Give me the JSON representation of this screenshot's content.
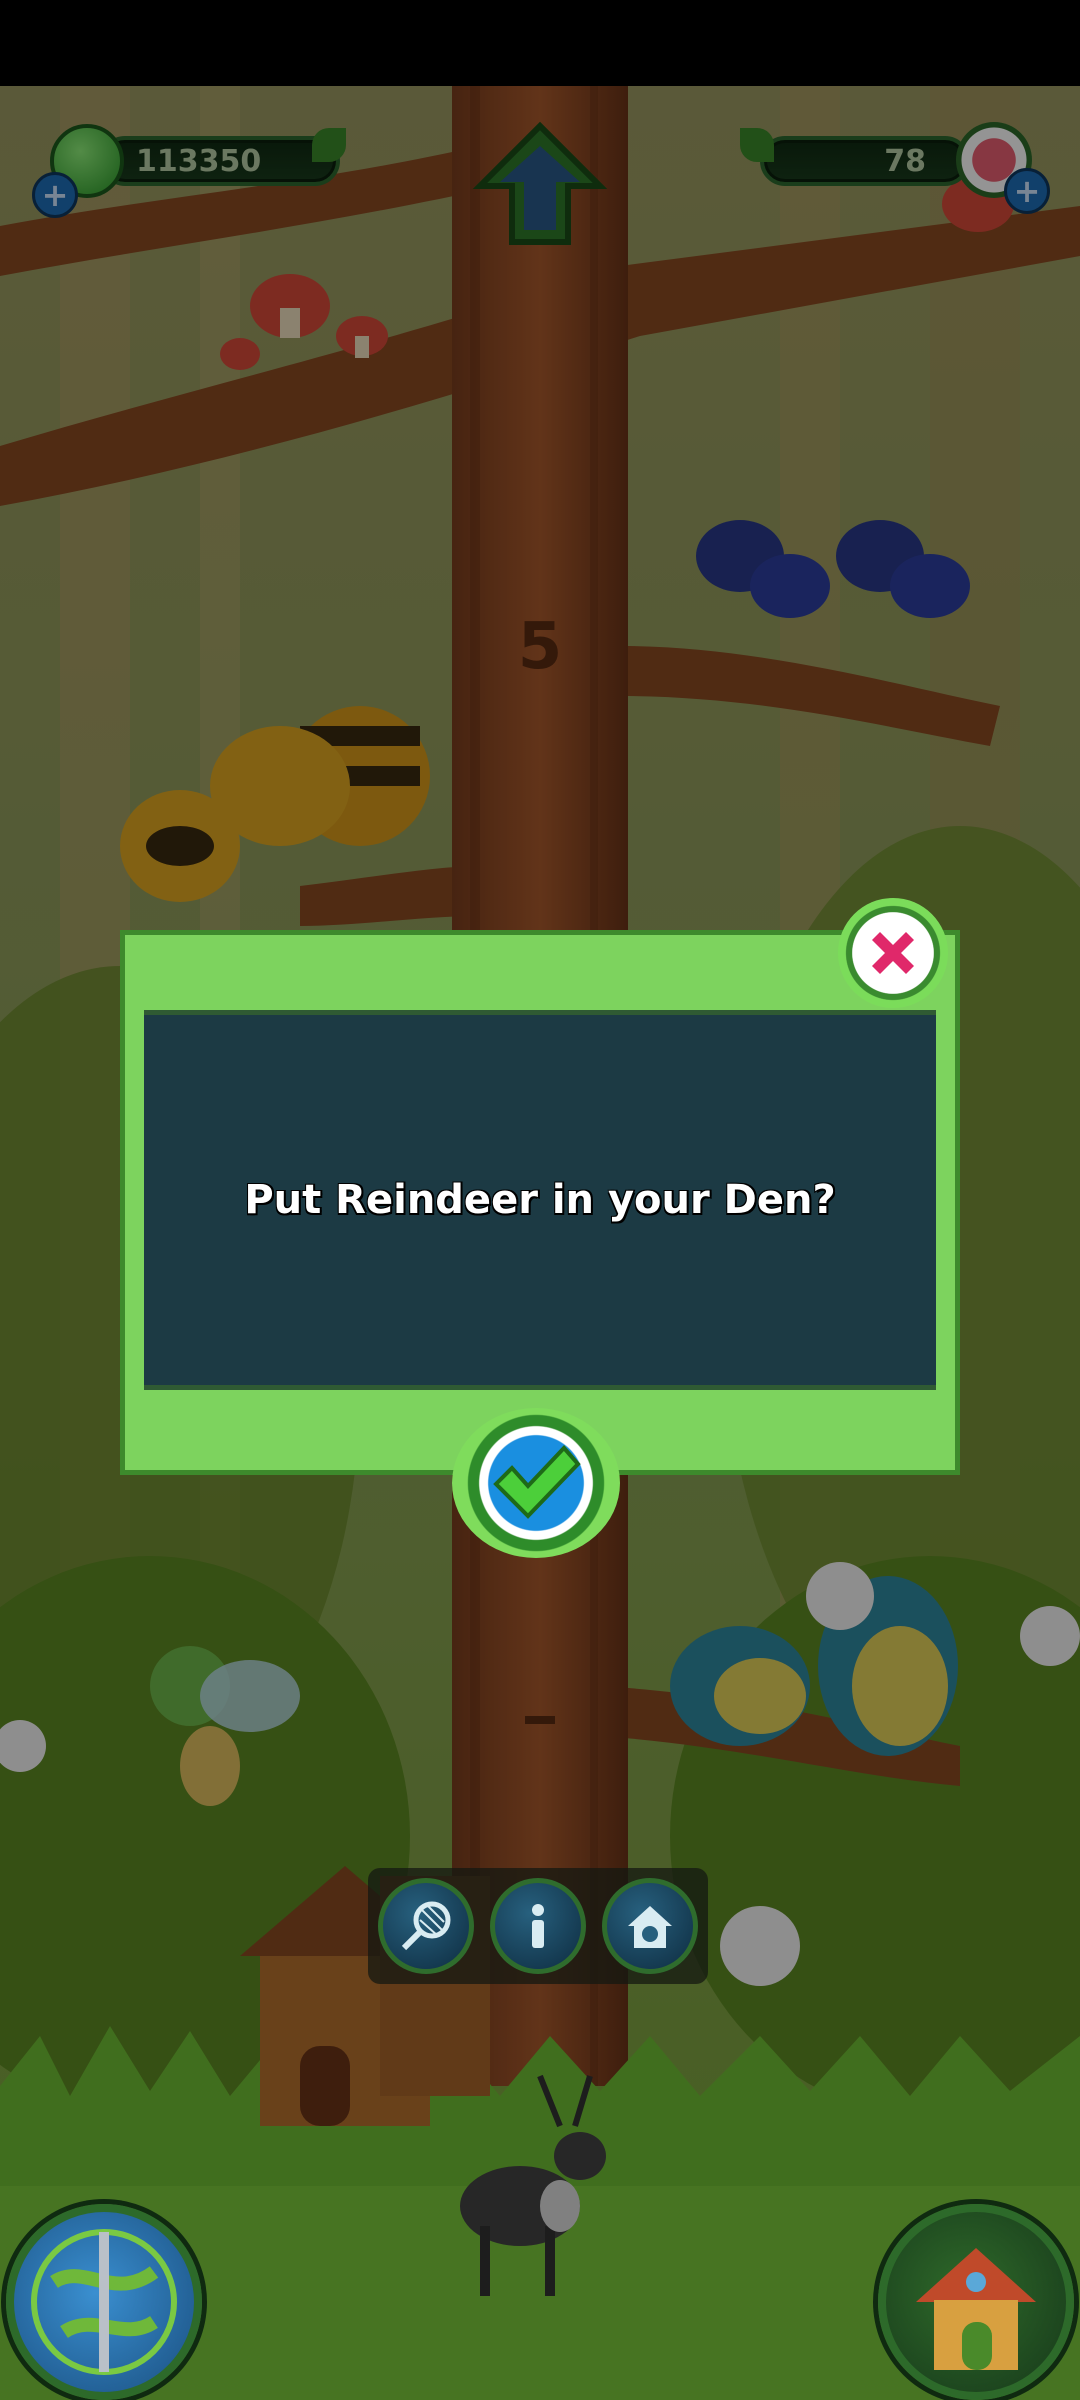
{
  "hud": {
    "currency_value": "113350",
    "gems_value": "78"
  },
  "tree": {
    "floor_marker": "5"
  },
  "dialog": {
    "message": "Put Reindeer in your Den?"
  },
  "toolbar": {
    "tools": [
      "net-icon",
      "info-icon",
      "den-icon"
    ]
  },
  "colors": {
    "dialog_green": "#7dd35e",
    "dialog_panel": "#1c3a44",
    "confirm_blue": "#1a8fe0",
    "close_pink": "#e0286a"
  }
}
